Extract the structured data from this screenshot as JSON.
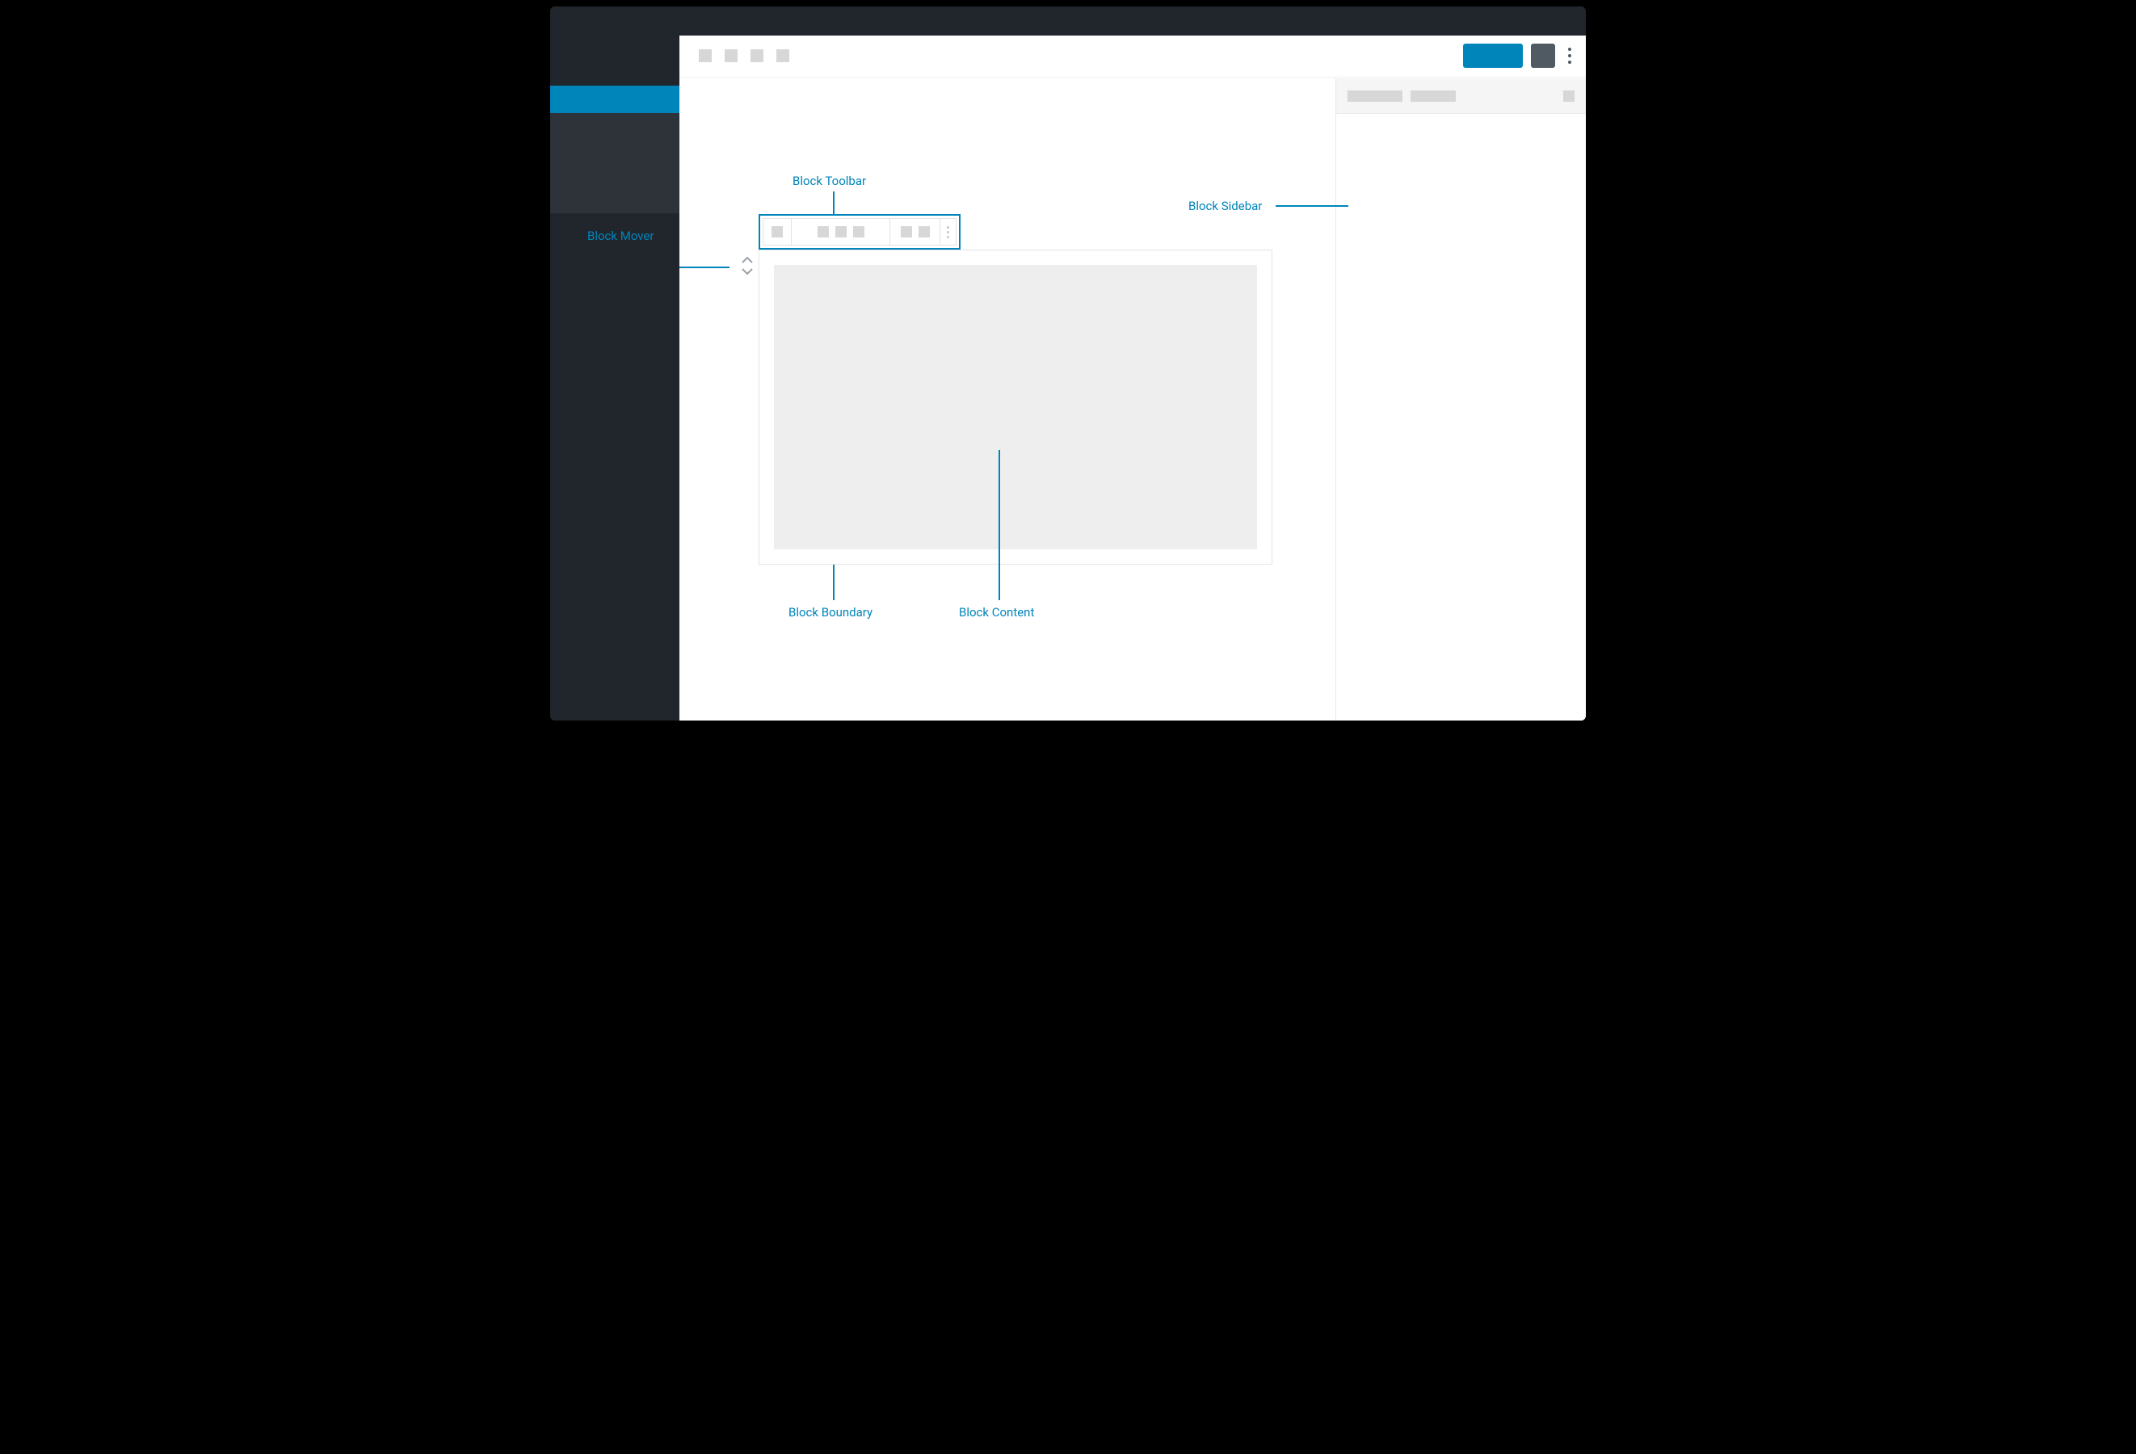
{
  "annotations": {
    "block_toolbar": "Block Toolbar",
    "block_sidebar": "Block Sidebar",
    "block_mover": "Block Mover",
    "block_boundary": "Block Boundary",
    "block_content": "Block Content"
  },
  "colors": {
    "accent": "#0085ba",
    "admin_bg": "#21262c",
    "admin_bg_darker": "#2d3339",
    "placeholder": "#d7d7d7",
    "canvas_fill": "#eeeeee",
    "grey_button": "#4f5a63"
  },
  "top_toolbar": {
    "left_icon_count": 4,
    "primary_button": "primary-action",
    "secondary_button": "settings-toggle"
  },
  "block_toolbar": {
    "group1_icons": 1,
    "group2_icons": 3,
    "group3_icons": 2,
    "has_more_menu": true
  },
  "settings_sidebar": {
    "tab_placeholders": 2,
    "has_close": true
  }
}
